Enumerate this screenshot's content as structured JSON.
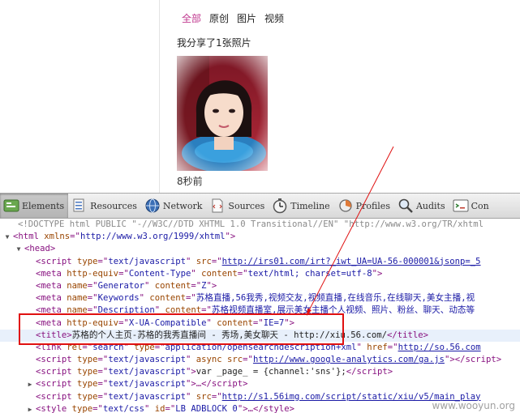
{
  "page": {
    "tabs": [
      {
        "label": "全部",
        "active": true
      },
      {
        "label": "原创",
        "active": false
      },
      {
        "label": "图片",
        "active": false
      },
      {
        "label": "视频",
        "active": false
      }
    ],
    "share_text": "我分享了1张照片",
    "time_text": "8秒前"
  },
  "toolbar": {
    "items": [
      {
        "label": "Elements",
        "icon": "elements-icon",
        "selected": true
      },
      {
        "label": "Resources",
        "icon": "resources-icon",
        "selected": false
      },
      {
        "label": "Network",
        "icon": "network-icon",
        "selected": false
      },
      {
        "label": "Sources",
        "icon": "sources-icon",
        "selected": false
      },
      {
        "label": "Timeline",
        "icon": "timeline-icon",
        "selected": false
      },
      {
        "label": "Profiles",
        "icon": "profiles-icon",
        "selected": false
      },
      {
        "label": "Audits",
        "icon": "audits-icon",
        "selected": false
      },
      {
        "label": "Con",
        "icon": "console-icon",
        "selected": false
      }
    ]
  },
  "source": {
    "doctype": "<!DOCTYPE html PUBLIC \"-//W3C//DTD XHTML 1.0 Transitional//EN\" \"http://www.w3.org/TR/xhtml",
    "html_ns": "http://www.w3.org/1999/xhtml",
    "script1_src": "http://irs01.com/irt?_iwt_UA=UA-56-000001&jsonp=_5",
    "meta_ct": "text/html; charset=utf-8",
    "generator": "Z",
    "keywords": "苏格直播,56我秀,视频交友,视频直播,在线音乐,在线聊天,美女主播,视",
    "description": "苏格视频直播室,展示美女主播个人视频、照片、粉丝、聊天、动态等",
    "ua_compat": "IE=7",
    "title": "苏格的个人主页-苏格的我秀直播间 - 秀场,美女聊天 - http://xiu.56.com/",
    "link_href": "http://so.56.com",
    "ga_src": "http://www.google-analytics.com/ga.js",
    "var_page": "var _page_ = {channel:'sns'};",
    "script_last_src": "http://s1.56img.com/script/static/xiu/v5/main_play",
    "style_id": "LB_ADBLOCK_0"
  },
  "watermark": "www.wooyun.org"
}
